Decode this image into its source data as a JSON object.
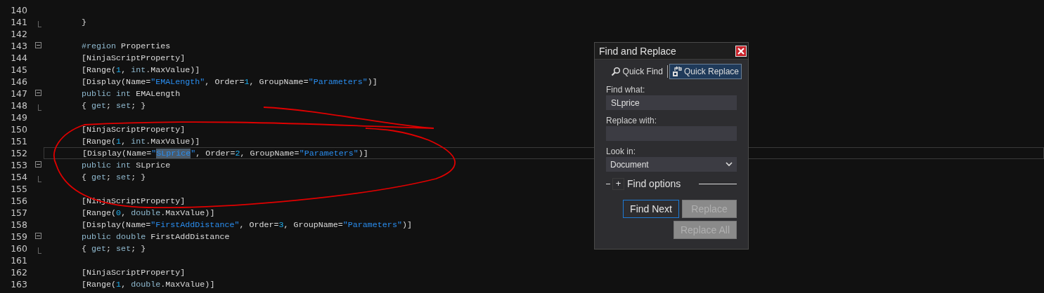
{
  "editor": {
    "lines": [
      {
        "number": "140",
        "current": false
      },
      {
        "number": "141",
        "current": false,
        "kind": "closing",
        "code": [
          {
            "kind": "text",
            "text": "}"
          }
        ]
      },
      {
        "number": "142",
        "current": false
      },
      {
        "number": "143",
        "current": false,
        "kind": "collapsible",
        "code": [
          {
            "kind": "keyword",
            "text": "#region"
          },
          {
            "kind": "text",
            "text": " Properties"
          }
        ]
      },
      {
        "number": "144",
        "current": false,
        "code": [
          {
            "kind": "text",
            "text": "[NinjaScriptProperty]"
          }
        ]
      },
      {
        "number": "145",
        "current": false,
        "code": [
          {
            "kind": "text",
            "text": "[Range("
          },
          {
            "kind": "number",
            "text": "1"
          },
          {
            "kind": "text",
            "text": ","
          },
          {
            "kind": "keyword",
            "text": " int"
          },
          {
            "kind": "text",
            "text": ".MaxValue)]"
          }
        ]
      },
      {
        "number": "146",
        "current": false,
        "code": [
          {
            "kind": "text",
            "text": "[Display(Name="
          },
          {
            "kind": "string",
            "text": "\"EMALength\""
          },
          {
            "kind": "text",
            "text": ", Order="
          },
          {
            "kind": "number",
            "text": "1"
          },
          {
            "kind": "text",
            "text": ", GroupName="
          },
          {
            "kind": "string",
            "text": "\"Parameters\""
          },
          {
            "kind": "text",
            "text": ")]"
          }
        ]
      },
      {
        "number": "147",
        "current": false,
        "kind": "collapsible",
        "code": [
          {
            "kind": "keyword",
            "text": "public int"
          },
          {
            "kind": "text",
            "text": " EMALength"
          }
        ]
      },
      {
        "number": "148",
        "current": false,
        "kind": "closing",
        "code": [
          {
            "kind": "text",
            "text": "{"
          },
          {
            "kind": "keyword",
            "text": " get"
          },
          {
            "kind": "text",
            "text": ";"
          },
          {
            "kind": "keyword",
            "text": " set"
          },
          {
            "kind": "text",
            "text": "; }"
          }
        ]
      },
      {
        "number": "149",
        "current": false
      },
      {
        "number": "150",
        "current": false,
        "code": [
          {
            "kind": "text",
            "text": "[NinjaScriptProperty]"
          }
        ]
      },
      {
        "number": "151",
        "current": false,
        "code": [
          {
            "kind": "text",
            "text": "[Range("
          },
          {
            "kind": "number",
            "text": "1"
          },
          {
            "kind": "text",
            "text": ","
          },
          {
            "kind": "keyword",
            "text": " int"
          },
          {
            "kind": "text",
            "text": ".MaxValue)]"
          }
        ]
      },
      {
        "number": "152",
        "current": true,
        "code": [
          {
            "kind": "text",
            "text": "[Display(Name="
          },
          {
            "kind": "string",
            "text": "\""
          },
          {
            "kind": "match",
            "text": "SLprice"
          },
          {
            "kind": "string",
            "text": "\""
          },
          {
            "kind": "text",
            "text": ", Order="
          },
          {
            "kind": "number",
            "text": "2"
          },
          {
            "kind": "text",
            "text": ", GroupName="
          },
          {
            "kind": "string",
            "text": "\"Parameters\""
          },
          {
            "kind": "text",
            "text": ")]"
          }
        ]
      },
      {
        "number": "153",
        "current": false,
        "kind": "collapsible",
        "code": [
          {
            "kind": "keyword",
            "text": "public int"
          },
          {
            "kind": "text",
            "text": " SLprice"
          }
        ]
      },
      {
        "number": "154",
        "current": false,
        "kind": "closing",
        "code": [
          {
            "kind": "text",
            "text": "{"
          },
          {
            "kind": "keyword",
            "text": " get"
          },
          {
            "kind": "text",
            "text": ";"
          },
          {
            "kind": "keyword",
            "text": " set"
          },
          {
            "kind": "text",
            "text": "; }"
          }
        ]
      },
      {
        "number": "155",
        "current": false
      },
      {
        "number": "156",
        "current": false,
        "code": [
          {
            "kind": "text",
            "text": "[NinjaScriptProperty]"
          }
        ]
      },
      {
        "number": "157",
        "current": false,
        "code": [
          {
            "kind": "text",
            "text": "[Range("
          },
          {
            "kind": "number",
            "text": "0"
          },
          {
            "kind": "text",
            "text": ","
          },
          {
            "kind": "keyword",
            "text": " double"
          },
          {
            "kind": "text",
            "text": ".MaxValue)]"
          }
        ]
      },
      {
        "number": "158",
        "current": false,
        "code": [
          {
            "kind": "text",
            "text": "[Display(Name="
          },
          {
            "kind": "string",
            "text": "\"FirstAddDistance\""
          },
          {
            "kind": "text",
            "text": ", Order="
          },
          {
            "kind": "number",
            "text": "3"
          },
          {
            "kind": "text",
            "text": ", GroupName="
          },
          {
            "kind": "string",
            "text": "\"Parameters\""
          },
          {
            "kind": "text",
            "text": ")]"
          }
        ]
      },
      {
        "number": "159",
        "current": false,
        "kind": "collapsible",
        "code": [
          {
            "kind": "keyword",
            "text": "public double"
          },
          {
            "kind": "text",
            "text": " FirstAddDistance"
          }
        ]
      },
      {
        "number": "160",
        "current": false,
        "kind": "closing",
        "code": [
          {
            "kind": "text",
            "text": "{"
          },
          {
            "kind": "keyword",
            "text": " get"
          },
          {
            "kind": "text",
            "text": ";"
          },
          {
            "kind": "keyword",
            "text": " set"
          },
          {
            "kind": "text",
            "text": "; }"
          }
        ]
      },
      {
        "number": "161",
        "current": false
      },
      {
        "number": "162",
        "current": false,
        "code": [
          {
            "kind": "text",
            "text": "[NinjaScriptProperty]"
          }
        ]
      },
      {
        "number": "163",
        "current": false,
        "code": [
          {
            "kind": "text",
            "text": "[Range("
          },
          {
            "kind": "number",
            "text": "1"
          },
          {
            "kind": "text",
            "text": ","
          },
          {
            "kind": "keyword",
            "text": " double"
          },
          {
            "kind": "text",
            "text": ".MaxValue)]"
          }
        ]
      }
    ]
  },
  "dialog": {
    "title": "Find and Replace",
    "tabs": [
      {
        "kind": "find",
        "label": "Quick Find",
        "selected": false
      },
      {
        "kind": "replace",
        "label": "Quick Replace",
        "selected": true
      }
    ],
    "fields": [
      {
        "label": "Find what:",
        "value": "SLprice"
      },
      {
        "label": "Replace with:"
      }
    ],
    "look_in": {
      "label": "Look in:",
      "value": "Document"
    },
    "find_options": {
      "toggle": "+",
      "label": "Find options",
      "expanded": false
    },
    "buttons": [
      {
        "label": "Find Next",
        "focused": true,
        "disabled": false
      },
      {
        "label": "Replace",
        "focused": false,
        "disabled": true
      },
      {
        "label": "Replace All",
        "focused": false,
        "disabled": true
      }
    ]
  }
}
